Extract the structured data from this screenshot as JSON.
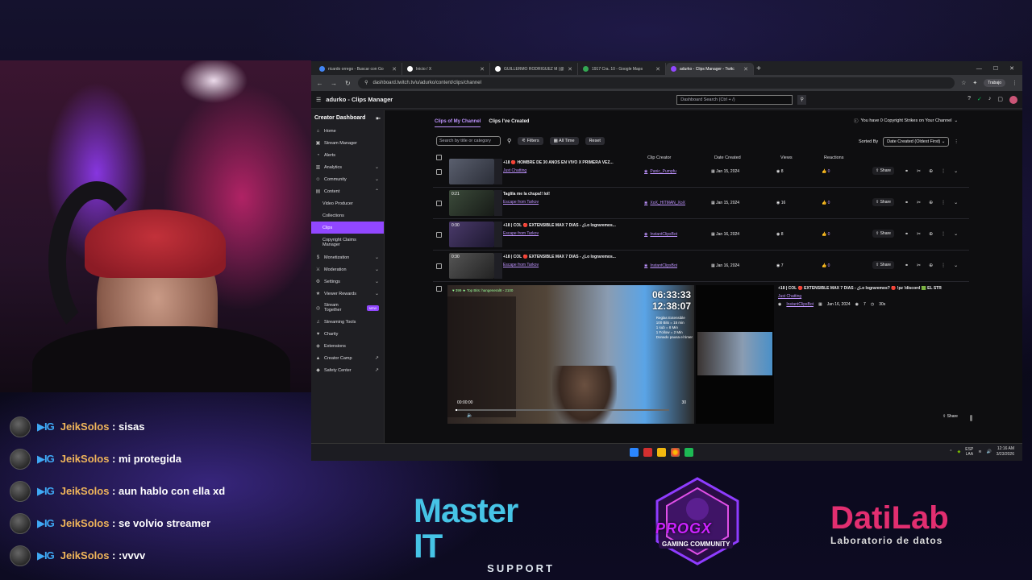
{
  "chat": {
    "messages": [
      {
        "user": "JeikSolos",
        "badge": "▶IG",
        "text": " : sisas"
      },
      {
        "user": "JeikSolos",
        "badge": "▶IG",
        "text": " : mi protegida"
      },
      {
        "user": "JeikSolos",
        "badge": "▶IG",
        "text": " : aun hablo con ella xd"
      },
      {
        "user": "JeikSolos",
        "badge": "▶IG",
        "text": " : se volvio streamer"
      },
      {
        "user": "JeikSolos",
        "badge": "▶IG",
        "text": " : :vvvv"
      }
    ]
  },
  "sponsors": {
    "master_title": "Master IT",
    "master_sub": "SUPPORT",
    "progx_title": "PROGX",
    "progx_sub": "GAMING COMMUNITY",
    "dati_title": "DatiLab",
    "dati_sub": "Laboratorio de datos"
  },
  "browser": {
    "tabs": [
      {
        "title": "ricardo orrego - Buscar con Go",
        "color": "#4285f4"
      },
      {
        "title": "Inicio / X",
        "color": "#ffffff"
      },
      {
        "title": "GUILLERMO RODRIGUEZ M (@",
        "color": "#ffffff"
      },
      {
        "title": "1917 Cra. 10 - Google Maps",
        "color": "#34a853"
      },
      {
        "title": "adurko - Clips Manager - Twitc",
        "color": "#9147ff"
      }
    ],
    "url": "dashboard.twitch.tv/u/adurko/content/clips/channel",
    "profile": "Trabajo"
  },
  "twitch": {
    "page_title": "adurko - Clips Manager",
    "search_placeholder": "Dashboard Search (Ctrl + /)",
    "sidebar": {
      "header": "Creator Dashboard",
      "items": [
        {
          "label": "Home",
          "icon": "⌂"
        },
        {
          "label": "Stream Manager",
          "icon": "▣"
        },
        {
          "label": "Alerts",
          "icon": "◔"
        },
        {
          "label": "Analytics",
          "icon": "▥"
        },
        {
          "label": "Community",
          "icon": "☺"
        },
        {
          "label": "Content",
          "icon": "▤"
        },
        {
          "label": "Video Producer"
        },
        {
          "label": "Collections"
        },
        {
          "label": "Clips"
        },
        {
          "label": "Copyright Claims Manager"
        },
        {
          "label": "Monetization",
          "icon": "$"
        },
        {
          "label": "Moderation",
          "icon": "⚔"
        },
        {
          "label": "Settings",
          "icon": "⚙"
        },
        {
          "label": "Viewer Rewards",
          "icon": "★"
        },
        {
          "label": "Stream Together",
          "icon": "◎",
          "badge": "NEW"
        },
        {
          "label": "Streaming Tools",
          "icon": "♫"
        },
        {
          "label": "Charity",
          "icon": "♥"
        },
        {
          "label": "Extensions",
          "icon": "◈"
        },
        {
          "label": "Creator Camp",
          "icon": "▲"
        },
        {
          "label": "Safety Center",
          "icon": "◆"
        }
      ]
    },
    "tabs": [
      "Clips of My Channel",
      "Clips I've Created"
    ],
    "copyright": "You have 0 Copyright Strikes on Your Channel",
    "search_clips_placeholder": "Search by title or category",
    "filters": "Filters",
    "all_time": "All Time",
    "reset": "Reset",
    "sorted_by": "Sorted By",
    "sort_value": "Date Created (Oldest First)",
    "columns": [
      "Clip Creator",
      "Date Created",
      "Views",
      "Reactions"
    ],
    "rows": [
      {
        "duration": "",
        "title": "+18 🔴 HOMBRE DE 30 AÑOS EN VIVO X PRIMERA VEZ...",
        "category": "Just Chatting",
        "creator": "Panic_Pumpfu",
        "date": "Jan 15, 2024",
        "views": "8",
        "reactions": "0",
        "share": "Share"
      },
      {
        "duration": "0:21",
        "title": "Taglila me la chupa!! lol!",
        "category": "Escape from Tarkov",
        "creator": "XoX_HITMAN_XoX",
        "date": "Jan 15, 2024",
        "views": "16",
        "reactions": "0",
        "share": "Share"
      },
      {
        "duration": "0:30",
        "title": "+18 | COL 🔴 EXTENSIBLE MAX 7 DIAS - ¿Lo lograremos...",
        "category": "Escape from Tarkov",
        "creator": "InstantClipsBot",
        "date": "Jan 16, 2024",
        "views": "8",
        "reactions": "0",
        "share": "Share"
      },
      {
        "duration": "0:30",
        "title": "+18 | COL 🔴 EXTENSIBLE MAX 7 DIAS - ¿Lo lograremos...",
        "category": "Escape from Tarkov",
        "creator": "InstantClipsBot",
        "date": "Jan 16, 2024",
        "views": "7",
        "reactions": "0",
        "share": "Share"
      }
    ],
    "expanded": {
      "title": "+18 | COL 🔴 EXTENSIBLE MAX 7 DIAS - ¿Lo lograremos? 🔴 !pz !discord 🟩 EL STR",
      "category": "Just Chatting",
      "creator": "InstantClipsBot",
      "date": "Jan 16, 2024",
      "views": "7",
      "duration": "30s",
      "share": "Share",
      "player_top": "♥ 399  ★ Top Bits: hangeneral8 - 2100",
      "timer1": "06:33:33",
      "timer2": "12:38:07",
      "rules": [
        "Reglas Extensible",
        "100 Bits = 15 min",
        "1 sub = 8 Min",
        "1 Follow = 2 Min",
        "Donado pausa el timer"
      ],
      "time": "00:00:00",
      "count": "30"
    }
  },
  "taskbar": {
    "lang1": "ESP",
    "lang2": "LAA",
    "time": "12:16 AM",
    "date": "3/23/2026"
  }
}
